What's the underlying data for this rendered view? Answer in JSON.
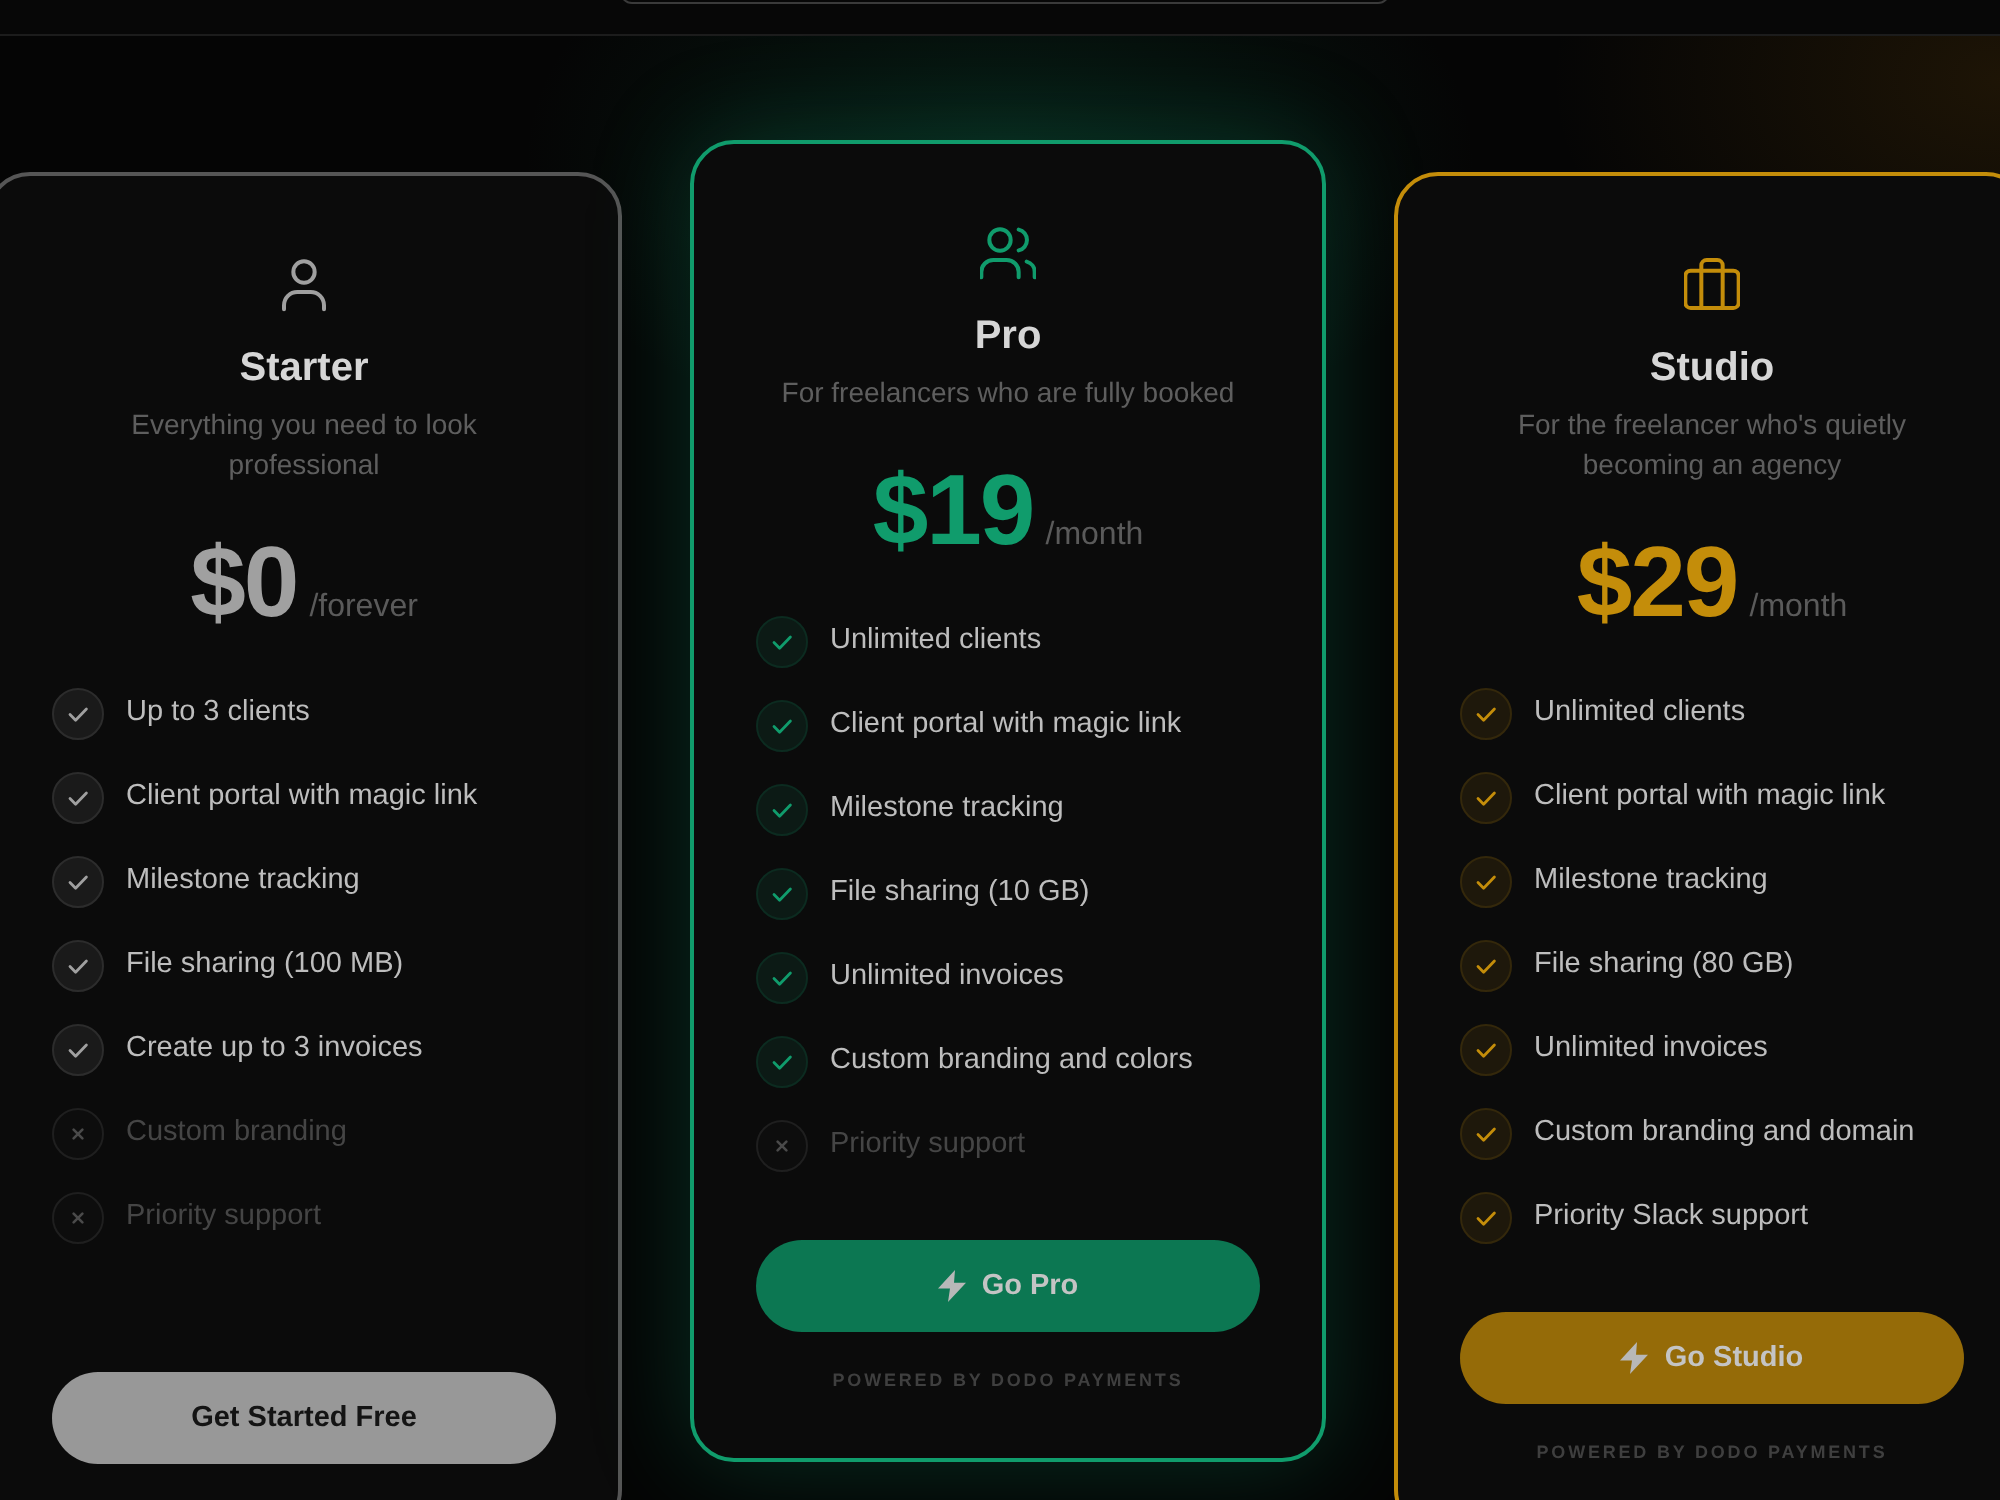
{
  "plans": [
    {
      "kind": "free",
      "name": "Starter",
      "featured": false,
      "color": "#a0a0a0",
      "description": "Everything you need to look professional",
      "price": "$0",
      "period": "/forever",
      "features": [
        {
          "text": "Up to 3 clients",
          "included": true
        },
        {
          "text": "Client portal with magic link",
          "included": true
        },
        {
          "text": "Milestone tracking",
          "included": true
        },
        {
          "text": "File sharing (100 MB)",
          "included": true
        },
        {
          "text": "Create up to 3 invoices",
          "included": true
        },
        {
          "text": "Custom branding",
          "included": false
        },
        {
          "text": "Priority support",
          "included": false
        }
      ],
      "button": "Get Started Free"
    },
    {
      "kind": "paid",
      "name": "Pro",
      "featured": true,
      "color": "#109c6c",
      "description": "For freelancers who are fully booked",
      "price": "$19",
      "period": "/month",
      "features": [
        {
          "text": "Unlimited clients",
          "included": true
        },
        {
          "text": "Client portal with magic link",
          "included": true
        },
        {
          "text": "Milestone tracking",
          "included": true
        },
        {
          "text": "File sharing (10 GB)",
          "included": true
        },
        {
          "text": "Unlimited invoices",
          "included": true
        },
        {
          "text": "Custom branding and colors",
          "included": true
        },
        {
          "text": "Priority support",
          "included": false
        }
      ],
      "button": "Go Pro",
      "footnote": "POWERED BY DODO PAYMENTS"
    },
    {
      "kind": "paid",
      "name": "Studio",
      "featured": false,
      "color": "#c48d0a",
      "description": "For the freelancer who's quietly becoming an agency",
      "price": "$29",
      "period": "/month",
      "features": [
        {
          "text": "Unlimited clients",
          "included": true
        },
        {
          "text": "Client portal with magic link",
          "included": true
        },
        {
          "text": "Milestone tracking",
          "included": true
        },
        {
          "text": "File sharing (80 GB)",
          "included": true
        },
        {
          "text": "Unlimited invoices",
          "included": true
        },
        {
          "text": "Custom branding and domain",
          "included": true
        },
        {
          "text": "Priority Slack support",
          "included": true
        }
      ],
      "button": "Go Studio",
      "footnote": "POWERED BY DODO PAYMENTS"
    }
  ]
}
